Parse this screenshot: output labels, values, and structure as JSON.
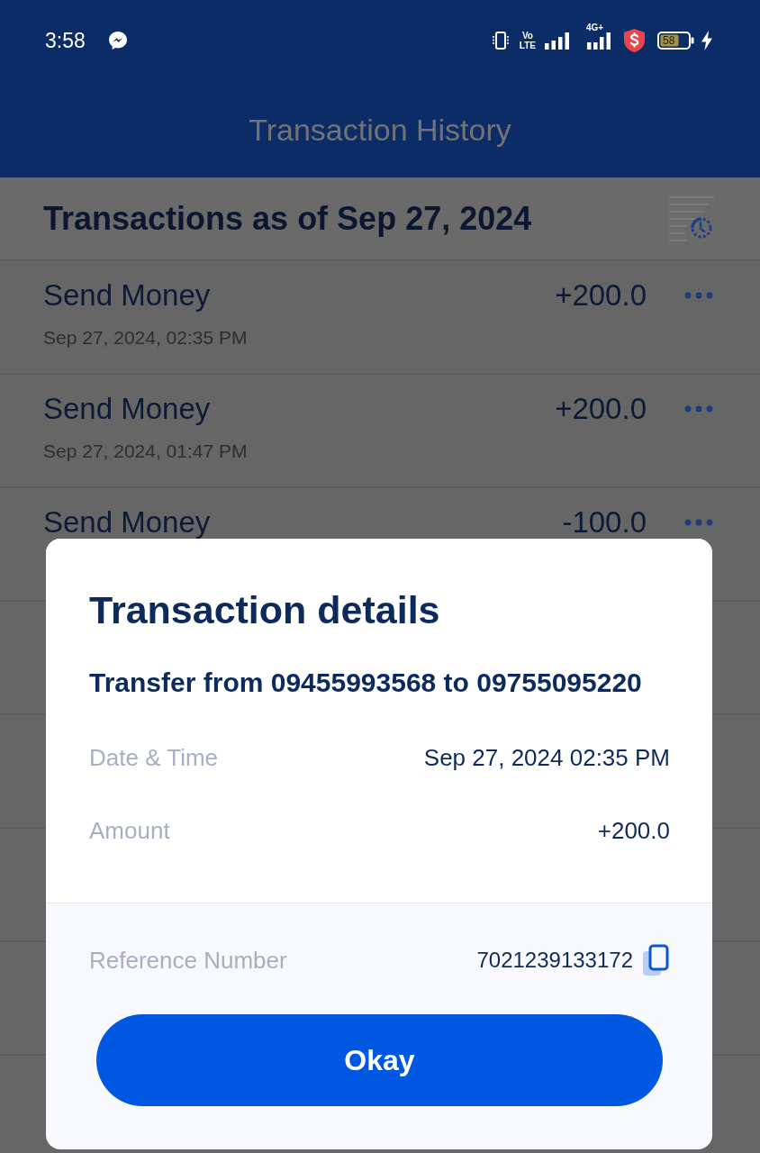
{
  "status_bar": {
    "time": "3:58",
    "volte": [
      "Vo",
      "LTE"
    ],
    "network": "4G+",
    "battery": "58"
  },
  "app_bar": {
    "title": "Transaction History"
  },
  "summary": {
    "title": "Transactions as of Sep 27, 2024"
  },
  "transactions": [
    {
      "title": "Send Money",
      "date": "Sep 27, 2024, 02:35 PM",
      "amount": "+200.0"
    },
    {
      "title": "Send Money",
      "date": "Sep 27, 2024, 01:47 PM",
      "amount": "+200.0"
    },
    {
      "title": "Send Money",
      "amount": "-100.0"
    }
  ],
  "dialog": {
    "title": "Transaction details",
    "subtitle": "Transfer from 09455993568 to 09755095220",
    "fields": [
      {
        "label": "Date & Time",
        "value": "Sep 27, 2024 02:35 PM"
      },
      {
        "label": "Amount",
        "value": "+200.0"
      }
    ],
    "reference": {
      "label": "Reference Number",
      "value": "7021239133172"
    },
    "button": "Okay"
  }
}
